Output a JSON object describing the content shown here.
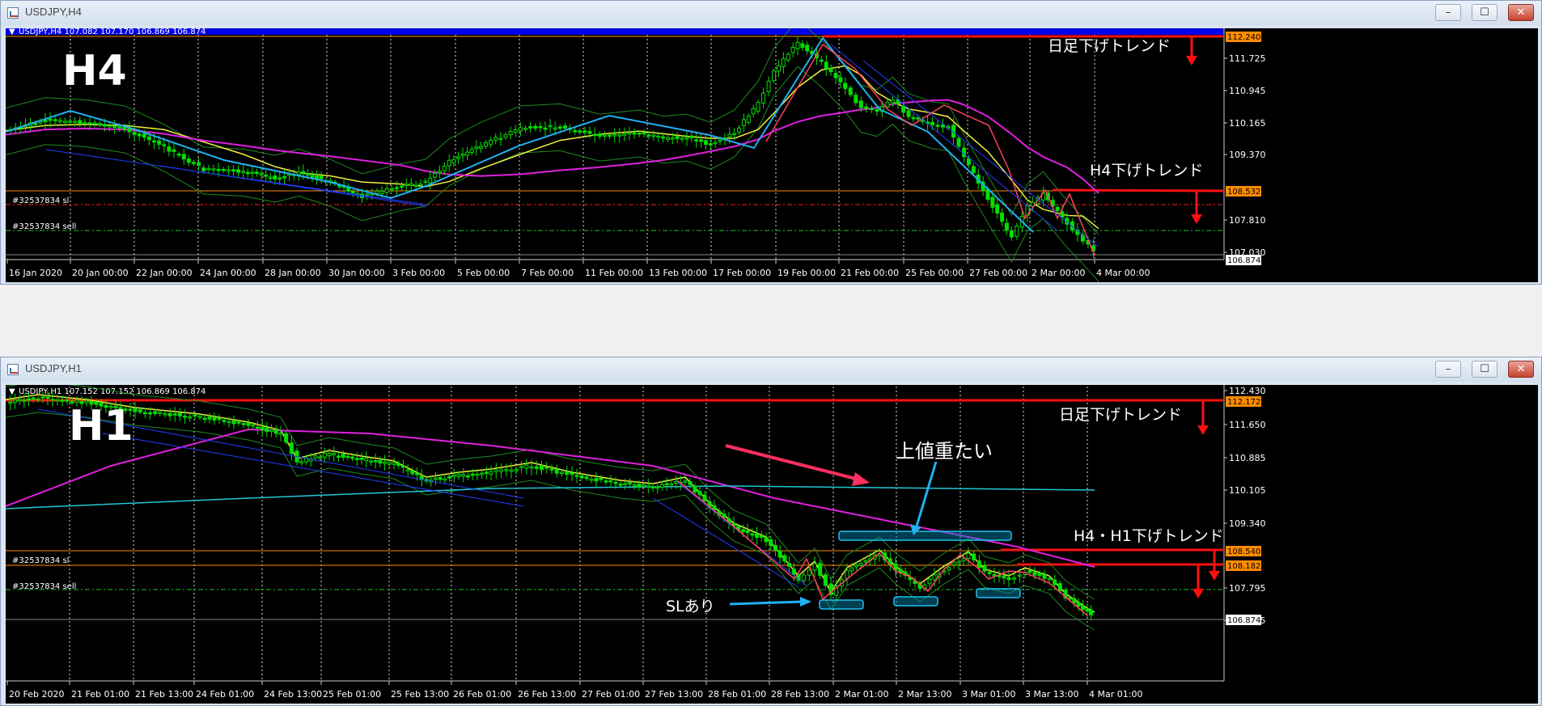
{
  "windows": [
    {
      "id": "h4",
      "title": "USDJPY,H4",
      "header": "USDJPY,H4  107.082 107.170 106.869 106.874",
      "label": "H4",
      "price_axis": [
        "111.725",
        "110.945",
        "110.165",
        "109.370",
        "107.810",
        "107.030"
      ],
      "price_badges": [
        {
          "text": "112.240",
          "color": "#ff8c00"
        },
        {
          "text": "108.532",
          "color": "#ff8c00"
        },
        {
          "text": "106.874",
          "color": "#ffffff"
        }
      ],
      "time_axis": [
        "16 Jan 2020",
        "20 Jan 00:00",
        "22 Jan 00:00",
        "24 Jan 00:00",
        "28 Jan 00:00",
        "30 Jan 00:00",
        "3 Feb 00:00",
        "5 Feb 00:00",
        "7 Feb 00:00",
        "11 Feb 00:00",
        "13 Feb 00:00",
        "17 Feb 00:00",
        "19 Feb 00:00",
        "21 Feb 00:00",
        "25 Feb 00:00",
        "27 Feb 00:00",
        "2 Mar 00:00",
        "4 Mar 00:00"
      ],
      "order_labels": [
        "#32537834 sl",
        "#32537834 sell"
      ],
      "annotations": [
        "日足下げトレンド",
        "H4下げトレンド"
      ]
    },
    {
      "id": "h1",
      "title": "USDJPY,H1",
      "header": "USDJPY,H1  107.152 107.152 106.869 106.874",
      "label": "H1",
      "price_axis": [
        "112.430",
        "111.650",
        "110.885",
        "110.105",
        "109.340",
        "107.795",
        "107.015"
      ],
      "price_badges": [
        {
          "text": "112.172",
          "color": "#ff8c00"
        },
        {
          "text": "108.540",
          "color": "#ff8c00"
        },
        {
          "text": "108.182",
          "color": "#ff8c00"
        },
        {
          "text": "106.874",
          "color": "#ffffff"
        }
      ],
      "time_axis": [
        "20 Feb 2020",
        "21 Feb 01:00",
        "21 Feb 13:00",
        "24 Feb 01:00",
        "24 Feb 13:00",
        "25 Feb 01:00",
        "25 Feb 13:00",
        "26 Feb 01:00",
        "26 Feb 13:00",
        "27 Feb 01:00",
        "27 Feb 13:00",
        "28 Feb 01:00",
        "28 Feb 13:00",
        "2 Mar 01:00",
        "2 Mar 13:00",
        "3 Mar 01:00",
        "3 Mar 13:00",
        "4 Mar 01:00"
      ],
      "order_labels": [
        "#32537834 sl",
        "#32537834 sell"
      ],
      "annotations": [
        "日足下げトレンド",
        "上値重たい",
        "H4・H1下げトレンド",
        "SLあり"
      ]
    }
  ],
  "chart_data": [
    {
      "type": "candlestick",
      "symbol": "USDJPY",
      "timeframe": "H4",
      "x_range": [
        "16 Jan 2020",
        "4 Mar 2020"
      ],
      "ylim": [
        106.874,
        112.24
      ],
      "close_path": [
        [
          0,
          109.95
        ],
        [
          0.05,
          110.2
        ],
        [
          0.1,
          110.15
        ],
        [
          0.15,
          110.0
        ],
        [
          0.2,
          109.55
        ],
        [
          0.25,
          109.0
        ],
        [
          0.3,
          108.95
        ],
        [
          0.34,
          108.8
        ],
        [
          0.37,
          108.95
        ],
        [
          0.41,
          108.7
        ],
        [
          0.45,
          108.35
        ],
        [
          0.5,
          108.6
        ],
        [
          0.53,
          108.7
        ],
        [
          0.56,
          109.2
        ],
        [
          0.6,
          109.6
        ],
        [
          0.65,
          110.0
        ],
        [
          0.7,
          110.05
        ],
        [
          0.75,
          109.8
        ],
        [
          0.8,
          109.9
        ],
        [
          0.83,
          109.75
        ],
        [
          0.86,
          109.8
        ],
        [
          0.89,
          109.6
        ],
        [
          0.92,
          109.9
        ],
        [
          0.95,
          110.6
        ],
        [
          0.97,
          111.4
        ],
        [
          1.0,
          112.1
        ],
        [
          1.03,
          111.6
        ],
        [
          1.06,
          111.0
        ],
        [
          1.08,
          110.5
        ],
        [
          1.1,
          110.4
        ],
        [
          1.12,
          110.7
        ],
        [
          1.14,
          110.3
        ],
        [
          1.17,
          110.1
        ],
        [
          1.19,
          110.05
        ],
        [
          1.21,
          109.3
        ],
        [
          1.24,
          108.3
        ],
        [
          1.27,
          107.35
        ],
        [
          1.29,
          108.1
        ],
        [
          1.31,
          108.4
        ],
        [
          1.34,
          107.7
        ],
        [
          1.36,
          107.3
        ],
        [
          1.38,
          106.87
        ]
      ],
      "support_resistance": [
        112.24,
        108.532
      ]
    },
    {
      "type": "candlestick",
      "symbol": "USDJPY",
      "timeframe": "H1",
      "x_range": [
        "20 Feb 2020",
        "4 Mar 2020"
      ],
      "ylim": [
        106.874,
        112.43
      ],
      "support_resistance": [
        112.172,
        108.54,
        108.182
      ]
    }
  ]
}
